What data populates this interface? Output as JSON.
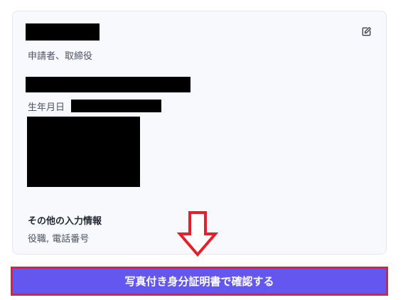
{
  "applicant": {
    "role": "申請者、取締役",
    "dob_label": "生年月日"
  },
  "other_info": {
    "title": "その他の入力情報",
    "value": "役職, 電話番号"
  },
  "icons": {
    "edit": "edit-icon",
    "arrow": "down-arrow-icon"
  },
  "cta": {
    "label": "写真付き身分証明書で確認する"
  },
  "colors": {
    "card_bg": "#f7f9fc",
    "cta_bg": "#6457f0",
    "highlight": "#e4202a",
    "redaction": "#000000"
  }
}
